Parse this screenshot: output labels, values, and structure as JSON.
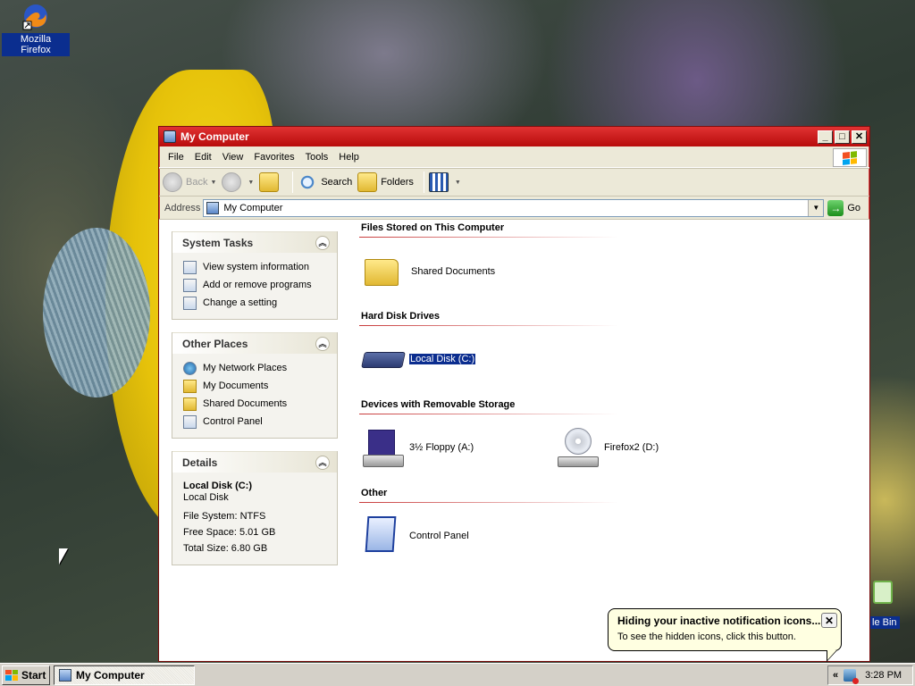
{
  "desktop": {
    "firefox_label": "Mozilla Firefox",
    "recycle_label": "le Bin"
  },
  "window": {
    "title": "My Computer",
    "minimize": "_",
    "maximize": "□",
    "close": "✕"
  },
  "menu": [
    "File",
    "Edit",
    "View",
    "Favorites",
    "Tools",
    "Help"
  ],
  "toolbar": {
    "back": "Back",
    "search": "Search",
    "folders": "Folders"
  },
  "address": {
    "label": "Address",
    "value": "My Computer",
    "go": "Go"
  },
  "tasks": {
    "system_title": "System Tasks",
    "system_items": [
      "View system information",
      "Add or remove programs",
      "Change a setting"
    ],
    "other_title": "Other Places",
    "other_items": [
      "My Network Places",
      "My Documents",
      "Shared Documents",
      "Control Panel"
    ],
    "details_title": "Details",
    "details": {
      "name": "Local Disk (C:)",
      "type": "Local Disk",
      "fs": "File System: NTFS",
      "free": "Free Space: 5.01 GB",
      "total": "Total Size: 6.80 GB"
    }
  },
  "content": {
    "sec_files": "Files Stored on This Computer",
    "shared_docs": "Shared Documents",
    "sec_hdd": "Hard Disk Drives",
    "local_disk": "Local Disk (C:)",
    "sec_removable": "Devices with Removable Storage",
    "floppy": "3½ Floppy (A:)",
    "cd": "Firefox2 (D:)",
    "sec_other": "Other",
    "control_panel": "Control Panel"
  },
  "balloon": {
    "title": "Hiding your inactive notification icons...",
    "message": "To see the hidden icons, click this button.",
    "close": "✕"
  },
  "taskbar": {
    "start": "Start",
    "task": "My Computer",
    "chevron": "«",
    "time": "3:28 PM"
  },
  "colors": {
    "title_red": "#c81414",
    "selection": "#0b2d8f"
  }
}
